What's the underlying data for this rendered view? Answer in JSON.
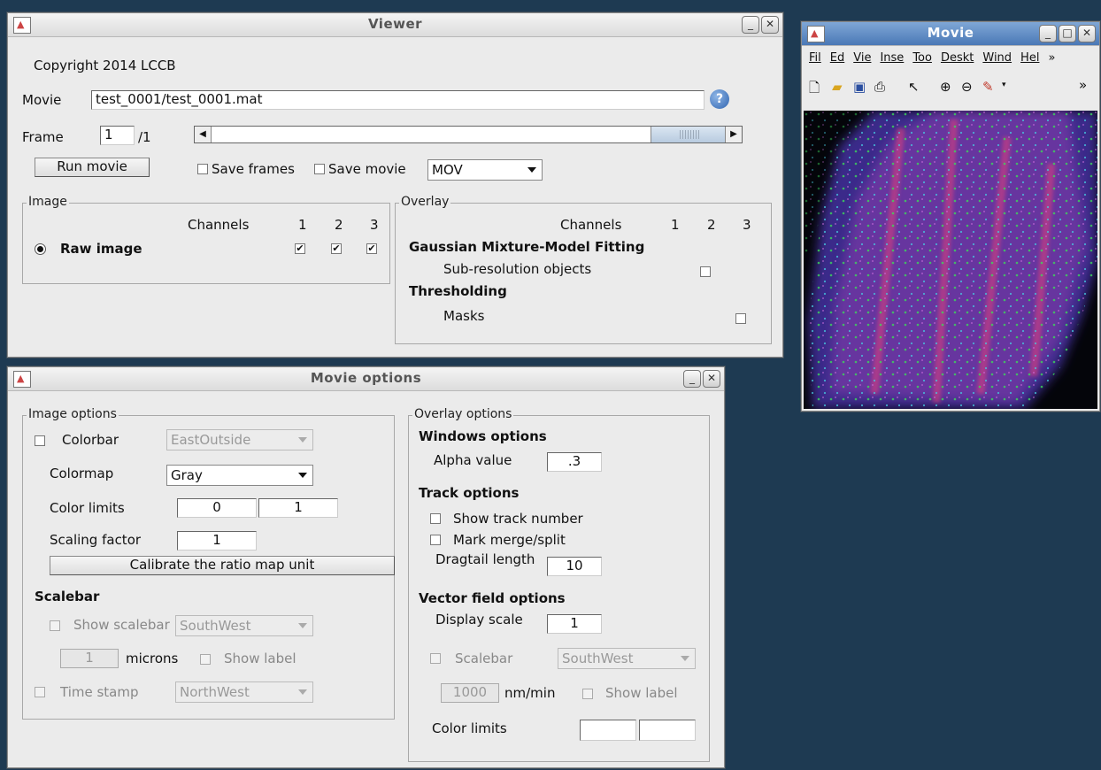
{
  "viewer": {
    "title": "Viewer",
    "copyright": "Copyright 2014 LCCB",
    "movie_label": "Movie",
    "movie_path": "test_0001/test_0001.mat",
    "help_glyph": "?",
    "frame_label": "Frame",
    "frame_value": "1",
    "frame_total": "/1",
    "run_movie": "Run movie",
    "save_frames": "Save frames",
    "save_movie": "Save movie",
    "format_value": "MOV",
    "image_group": {
      "title": "Image",
      "channels_label": "Channels",
      "ch1": "1",
      "ch2": "2",
      "ch3": "3",
      "raw_image": "Raw image",
      "checked": [
        true,
        true,
        true
      ]
    },
    "overlay_group": {
      "title": "Overlay",
      "channels_label": "Channels",
      "ch1": "1",
      "ch2": "2",
      "ch3": "3",
      "gmm_title": "Gaussian Mixture-Model Fitting",
      "subres": "Sub-resolution objects",
      "thresh_title": "Thresholding",
      "masks": "Masks"
    }
  },
  "movie_window": {
    "title": "Movie",
    "menu": [
      "Fil",
      "Ed",
      "Vie",
      "Inse",
      "Too",
      "Deskt",
      "Wind",
      "Hel"
    ],
    "menu_more": "»",
    "toolbar_more": "»"
  },
  "options": {
    "title": "Movie options",
    "image_options": {
      "title": "Image options",
      "colorbar": "Colorbar",
      "colorbar_location": "EastOutside",
      "colormap_label": "Colormap",
      "colormap_value": "Gray",
      "color_limits_label": "Color limits",
      "color_min": "0",
      "color_max": "1",
      "scaling_label": "Scaling factor",
      "scaling_value": "1",
      "calibrate": "Calibrate the ratio map unit",
      "scalebar_title": "Scalebar",
      "show_scalebar": "Show scalebar",
      "scalebar_location": "SouthWest",
      "scalebar_value": "1",
      "microns": "microns",
      "show_label": "Show label",
      "time_stamp": "Time stamp",
      "time_location": "NorthWest"
    },
    "overlay_options": {
      "title": "Overlay options",
      "windows_title": "Windows options",
      "alpha_label": "Alpha value",
      "alpha_value": ".3",
      "track_title": "Track options",
      "show_track_number": "Show track number",
      "mark_merge": "Mark merge/split",
      "dragtail_label": "Dragtail length",
      "dragtail_value": "10",
      "vector_title": "Vector field options",
      "display_scale_label": "Display scale",
      "display_scale_value": "1",
      "scalebar": "Scalebar",
      "scalebar_location": "SouthWest",
      "scalebar_value": "1000",
      "unit": "nm/min",
      "show_label": "Show label",
      "color_limits_label": "Color limits",
      "color_min": "",
      "color_max": ""
    }
  }
}
